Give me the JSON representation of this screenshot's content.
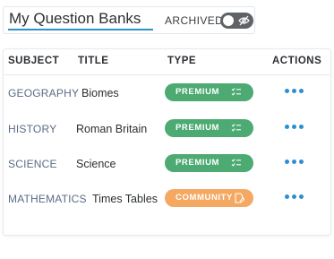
{
  "header": {
    "title": "My Question Banks",
    "archived_label": "ARCHIVED",
    "archived_toggle": {
      "on": false,
      "icon": "eye-off-icon"
    }
  },
  "table": {
    "columns": [
      "SUBJECT",
      "TITLE",
      "TYPE",
      "ACTIONS"
    ],
    "rows": [
      {
        "subject": "GEOGRAPHY",
        "title": "Biomes",
        "type": "PREMIUM",
        "type_color": "#4caa72",
        "icon": "checklist-icon",
        "actions_icon": "more-dots-icon"
      },
      {
        "subject": "HISTORY",
        "title": "Roman Britain",
        "type": "PREMIUM",
        "type_color": "#4caa72",
        "icon": "checklist-icon",
        "actions_icon": "more-dots-icon"
      },
      {
        "subject": "SCIENCE",
        "title": "Science",
        "type": "PREMIUM",
        "type_color": "#4caa72",
        "icon": "checklist-icon",
        "actions_icon": "more-dots-icon"
      },
      {
        "subject": "MATHEMATICS",
        "title": "Times Tables",
        "type": "COMMUNITY",
        "type_color": "#f4a862",
        "icon": "edit-document-icon",
        "actions_icon": "more-dots-icon"
      }
    ]
  },
  "colors": {
    "accent": "#2f8fcd",
    "premium": "#4caa72",
    "community": "#f4a862",
    "toggle_off": "#5f6266"
  }
}
